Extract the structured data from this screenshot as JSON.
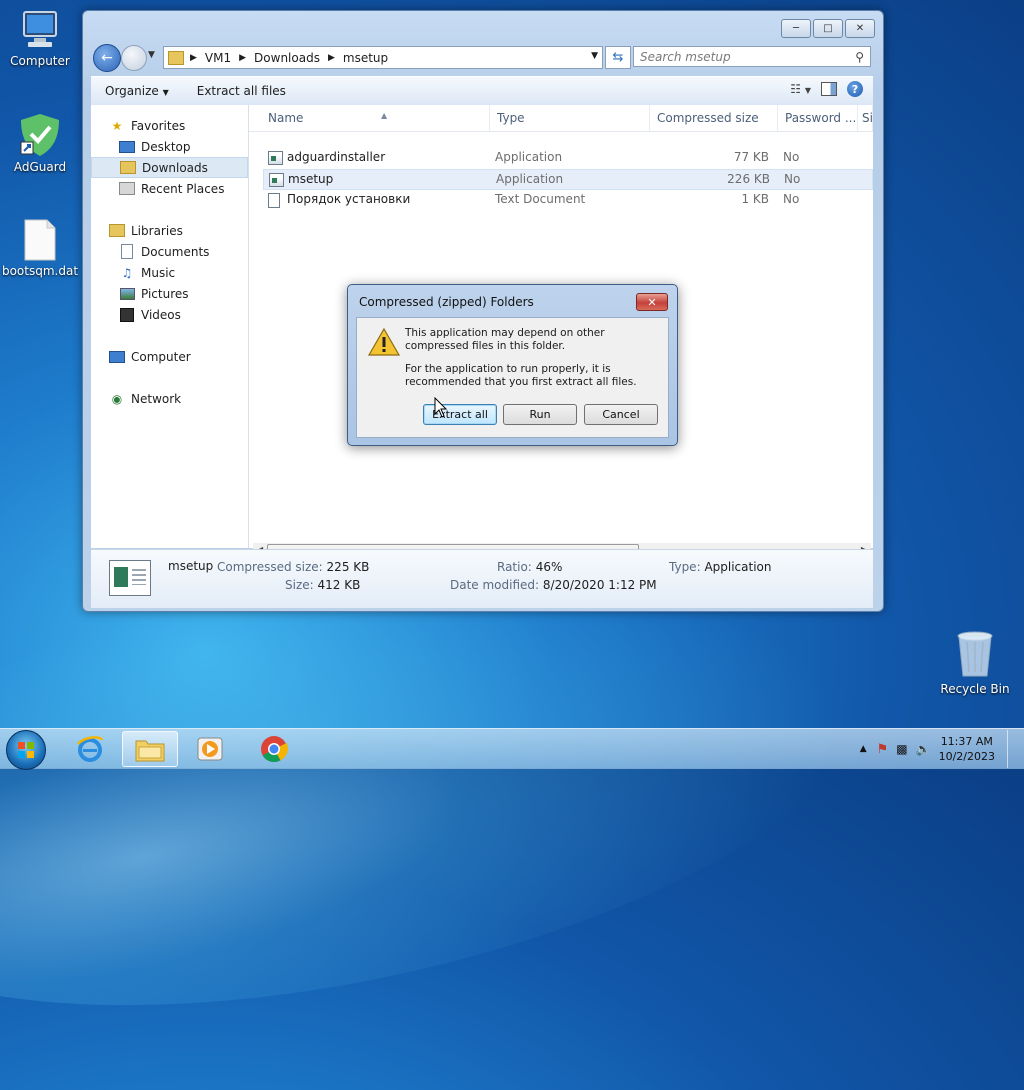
{
  "desktop": {
    "icons": [
      {
        "label": "Computer"
      },
      {
        "label": "AdGuard"
      },
      {
        "label": "bootsqm.dat"
      },
      {
        "label": "Recycle Bin"
      }
    ]
  },
  "explorer": {
    "address": {
      "crumbs": [
        "VM1",
        "Downloads",
        "msetup"
      ]
    },
    "search_placeholder": "Search msetup",
    "toolbar": {
      "organize": "Organize",
      "extract_all": "Extract all files"
    },
    "nav": {
      "favorites": "Favorites",
      "desktop": "Desktop",
      "downloads": "Downloads",
      "recent_places": "Recent Places",
      "libraries": "Libraries",
      "documents": "Documents",
      "music": "Music",
      "pictures": "Pictures",
      "videos": "Videos",
      "computer": "Computer",
      "network": "Network"
    },
    "columns": {
      "name": "Name",
      "type": "Type",
      "compressed_size": "Compressed size",
      "password": "Password ...",
      "size": "Si"
    },
    "files": [
      {
        "name": "adguardinstaller",
        "type": "Application",
        "compressed_size": "77 KB",
        "password": "No"
      },
      {
        "name": "msetup",
        "type": "Application",
        "compressed_size": "226 KB",
        "password": "No"
      },
      {
        "name": "Порядок установки",
        "type": "Text Document",
        "compressed_size": "1 KB",
        "password": "No"
      }
    ],
    "details": {
      "name": "msetup",
      "compressed_size_label": "Compressed size:",
      "compressed_size": "225 KB",
      "size_label": "Size:",
      "size": "412 KB",
      "ratio_label": "Ratio:",
      "ratio": "46%",
      "date_label": "Date modified:",
      "date": "8/20/2020 1:12 PM",
      "type_label": "Type:",
      "type": "Application"
    }
  },
  "dialog": {
    "title": "Compressed (zipped) Folders",
    "message1": "This application may depend on other compressed files in this folder.",
    "message2": "For the application to run properly, it is recommended that you first extract all files.",
    "btn_extract": "Extract all",
    "btn_run": "Run",
    "btn_cancel": "Cancel"
  },
  "taskbar": {
    "time": "11:37 AM",
    "date": "10/2/2023"
  }
}
